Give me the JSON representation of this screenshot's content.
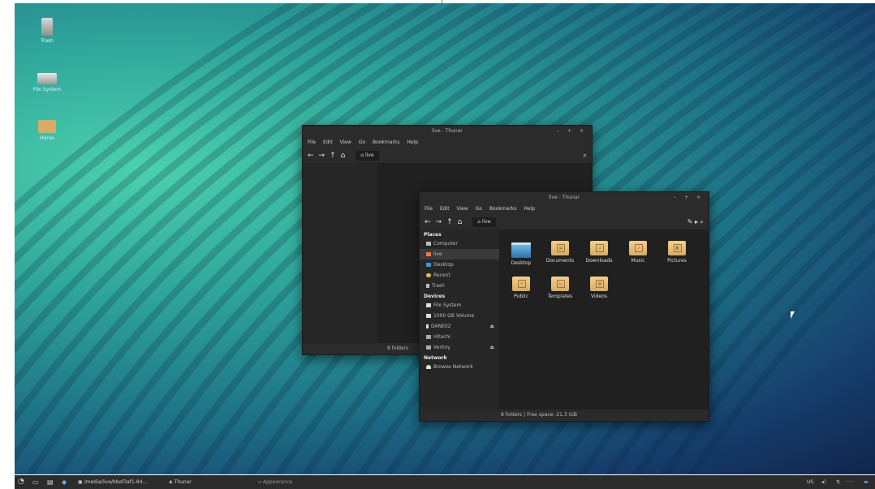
{
  "desktop_icons": [
    {
      "label": "Trash",
      "icon": "trash-icon"
    },
    {
      "label": "File System",
      "icon": "drive-icon"
    },
    {
      "label": "Home",
      "icon": "home-folder-icon"
    }
  ],
  "back_window": {
    "title": "live - Thunar",
    "menu": [
      "File",
      "Edit",
      "View",
      "Go",
      "Bookmarks",
      "Help"
    ],
    "location": "live",
    "status": "8 folders"
  },
  "front_window": {
    "title": "live - Thunar",
    "menu": [
      "File",
      "Edit",
      "View",
      "Go",
      "Bookmarks",
      "Help"
    ],
    "location": "live",
    "status": "8 folders  |  Free space: 21.3 GiB",
    "sidebar": {
      "places_header": "Places",
      "places": [
        "Computer",
        "live",
        "Desktop",
        "Recent",
        "Trash"
      ],
      "devices_header": "Devices",
      "devices": [
        "File System",
        "1000 GB Volume",
        "DANE02",
        "Hitachi",
        "Ventoy"
      ],
      "network_header": "Network",
      "network": [
        "Browse Network"
      ]
    },
    "files": [
      "Desktop",
      "Documents",
      "Downloads",
      "Music",
      "Pictures",
      "Public",
      "Templates",
      "Videos"
    ]
  },
  "taskbar": {
    "path_task": "/media/live/bbaf3af1-84...",
    "thunar_task": "Thunar",
    "appearance_task": "Appearance",
    "keyboard_layout": "US"
  },
  "colors": {
    "folder": "#d9aa63",
    "panel": "#2c2c2c",
    "window_bg": "#202020"
  }
}
